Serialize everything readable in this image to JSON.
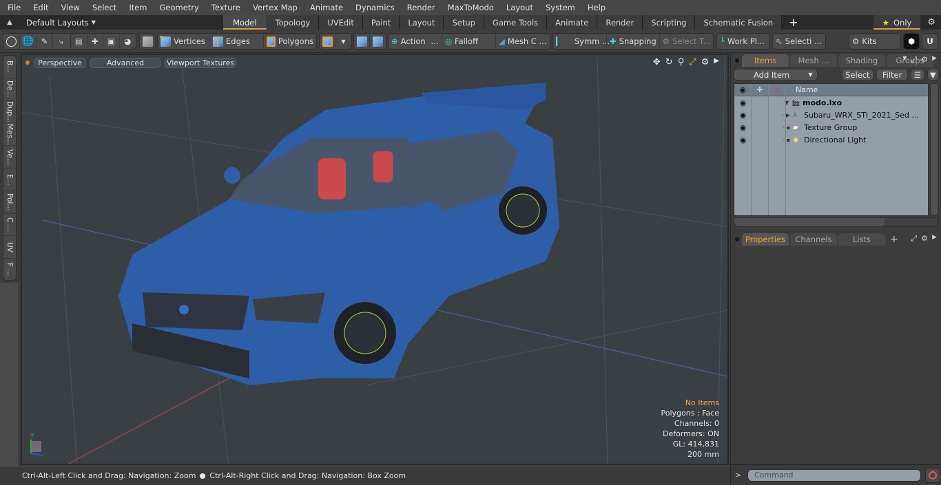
{
  "menu": [
    "File",
    "Edit",
    "View",
    "Select",
    "Item",
    "Geometry",
    "Texture",
    "Vertex Map",
    "Animate",
    "Dynamics",
    "Render",
    "MaxToModo",
    "Layout",
    "System",
    "Help"
  ],
  "layout_bar": {
    "layouts_label": "Default Layouts",
    "tabs": [
      "Model",
      "Topology",
      "UVEdit",
      "Paint",
      "Layout",
      "Setup",
      "Game Tools",
      "Animate",
      "Render",
      "Scripting",
      "Schematic Fusion"
    ],
    "active_tab": "Model",
    "only_label": "Only"
  },
  "toolbar": {
    "vertices": "Vertices",
    "edges": "Edges",
    "polygons": "Polygons",
    "action": "Action",
    "falloff": "Falloff",
    "mesh_c": "Mesh C ...",
    "symm": "Symm ...",
    "snapping": "Snapping",
    "select_t": "Select T...",
    "work_pl": "Work Pl...",
    "selecti": "Selecti ...",
    "kits": "Kits"
  },
  "left_tabs": [
    "B...",
    "De...",
    "Dup...",
    "Mes...",
    "Ve...",
    "E...",
    "Pol...",
    "C ...",
    "UV",
    "F ..."
  ],
  "viewport": {
    "view_mode": "Perspective",
    "shading": "Advanced",
    "textures": "Viewport Textures",
    "info": {
      "selection": "No Items",
      "polygons": "Polygons : Face",
      "channels": "Channels: 0",
      "deformers": "Deformers: ON",
      "gl": "GL: 414,831",
      "scale": "200 mm"
    }
  },
  "status": {
    "hint_left": "Ctrl-Alt-Left Click and Drag: Navigation: Zoom",
    "hint_right": "Ctrl-Alt-Right Click and Drag: Navigation: Box Zoom"
  },
  "items_panel": {
    "tabs": [
      "Items",
      "Mesh ...",
      "Shading",
      "Groups"
    ],
    "active_tab": "Items",
    "add_item": "Add Item",
    "select": "Select",
    "filter": "Filter",
    "name_header": "Name",
    "tree": [
      {
        "label": "modo.lxo",
        "level": 0,
        "bold": true,
        "icon": "scene-icon"
      },
      {
        "label": "Subaru_WRX_STI_2021_Sed ...",
        "level": 1,
        "icon": "mesh-locator-icon"
      },
      {
        "label": "Texture Group",
        "level": 1,
        "icon": "texture-group-icon"
      },
      {
        "label": "Directional Light",
        "level": 1,
        "icon": "light-icon"
      }
    ]
  },
  "props_panel": {
    "tabs": [
      "Properties",
      "Channels",
      "Lists"
    ],
    "active_tab": "Properties"
  },
  "command": {
    "placeholder": "Command"
  },
  "colors": {
    "accent": "#e09a3a",
    "car_body": "#2f5ea8",
    "tree_bg": "#959ea6"
  }
}
